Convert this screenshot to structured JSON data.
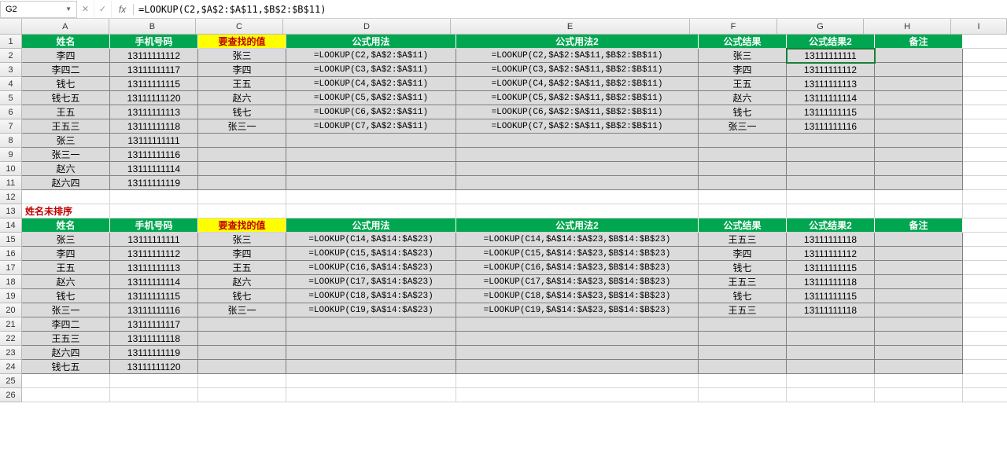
{
  "nameBox": "G2",
  "formula": "=LOOKUP(C2,$A$2:$A$11,$B$2:$B$11)",
  "columns": [
    "A",
    "B",
    "C",
    "D",
    "E",
    "F",
    "G",
    "H",
    "I"
  ],
  "header1": {
    "A": "姓名",
    "B": "手机号码",
    "C": "要查找的值",
    "D": "公式用法",
    "E": "公式用法2",
    "F": "公式结果",
    "G": "公式结果2",
    "H": "备注"
  },
  "section1Label": "姓名未排序",
  "chart_data": {
    "type": "table",
    "tables": [
      {
        "title": "LOOKUP sorted",
        "rows": [
          {
            "row": 2,
            "A": "李四",
            "B": "13111111112",
            "C": "张三",
            "D": "=LOOKUP(C2,$A$2:$A$11)",
            "E": "=LOOKUP(C2,$A$2:$A$11,$B$2:$B$11)",
            "F": "张三",
            "G": "13111111111"
          },
          {
            "row": 3,
            "A": "李四二",
            "B": "13111111117",
            "C": "李四",
            "D": "=LOOKUP(C3,$A$2:$A$11)",
            "E": "=LOOKUP(C3,$A$2:$A$11,$B$2:$B$11)",
            "F": "李四",
            "G": "13111111112"
          },
          {
            "row": 4,
            "A": "钱七",
            "B": "13111111115",
            "C": "王五",
            "D": "=LOOKUP(C4,$A$2:$A$11)",
            "E": "=LOOKUP(C4,$A$2:$A$11,$B$2:$B$11)",
            "F": "王五",
            "G": "13111111113"
          },
          {
            "row": 5,
            "A": "钱七五",
            "B": "13111111120",
            "C": "赵六",
            "D": "=LOOKUP(C5,$A$2:$A$11)",
            "E": "=LOOKUP(C5,$A$2:$A$11,$B$2:$B$11)",
            "F": "赵六",
            "G": "13111111114"
          },
          {
            "row": 6,
            "A": "王五",
            "B": "13111111113",
            "C": "钱七",
            "D": "=LOOKUP(C6,$A$2:$A$11)",
            "E": "=LOOKUP(C6,$A$2:$A$11,$B$2:$B$11)",
            "F": "钱七",
            "G": "13111111115"
          },
          {
            "row": 7,
            "A": "王五三",
            "B": "13111111118",
            "C": "张三一",
            "D": "=LOOKUP(C7,$A$2:$A$11)",
            "E": "=LOOKUP(C7,$A$2:$A$11,$B$2:$B$11)",
            "F": "张三一",
            "G": "13111111116"
          },
          {
            "row": 8,
            "A": "张三",
            "B": "13111111111"
          },
          {
            "row": 9,
            "A": "张三一",
            "B": "13111111116"
          },
          {
            "row": 10,
            "A": "赵六",
            "B": "13111111114"
          },
          {
            "row": 11,
            "A": "赵六四",
            "B": "13111111119"
          }
        ]
      },
      {
        "title": "LOOKUP unsorted",
        "rows": [
          {
            "row": 15,
            "A": "张三",
            "B": "13111111111",
            "C": "张三",
            "D": "=LOOKUP(C14,$A$14:$A$23)",
            "E": "=LOOKUP(C14,$A$14:$A$23,$B$14:$B$23)",
            "F": "王五三",
            "G": "13111111118"
          },
          {
            "row": 16,
            "A": "李四",
            "B": "13111111112",
            "C": "李四",
            "D": "=LOOKUP(C15,$A$14:$A$23)",
            "E": "=LOOKUP(C15,$A$14:$A$23,$B$14:$B$23)",
            "F": "李四",
            "G": "13111111112"
          },
          {
            "row": 17,
            "A": "王五",
            "B": "13111111113",
            "C": "王五",
            "D": "=LOOKUP(C16,$A$14:$A$23)",
            "E": "=LOOKUP(C16,$A$14:$A$23,$B$14:$B$23)",
            "F": "钱七",
            "G": "13111111115"
          },
          {
            "row": 18,
            "A": "赵六",
            "B": "13111111114",
            "C": "赵六",
            "D": "=LOOKUP(C17,$A$14:$A$23)",
            "E": "=LOOKUP(C17,$A$14:$A$23,$B$14:$B$23)",
            "F": "王五三",
            "G": "13111111118"
          },
          {
            "row": 19,
            "A": "钱七",
            "B": "13111111115",
            "C": "钱七",
            "D": "=LOOKUP(C18,$A$14:$A$23)",
            "E": "=LOOKUP(C18,$A$14:$A$23,$B$14:$B$23)",
            "F": "钱七",
            "G": "13111111115"
          },
          {
            "row": 20,
            "A": "张三一",
            "B": "13111111116",
            "C": "张三一",
            "D": "=LOOKUP(C19,$A$14:$A$23)",
            "E": "=LOOKUP(C19,$A$14:$A$23,$B$14:$B$23)",
            "F": "王五三",
            "G": "13111111118"
          },
          {
            "row": 21,
            "A": "李四二",
            "B": "13111111117"
          },
          {
            "row": 22,
            "A": "王五三",
            "B": "13111111118"
          },
          {
            "row": 23,
            "A": "赵六四",
            "B": "13111111119"
          },
          {
            "row": 24,
            "A": "钱七五",
            "B": "13111111120"
          }
        ]
      }
    ]
  },
  "fxLabel": "fx"
}
